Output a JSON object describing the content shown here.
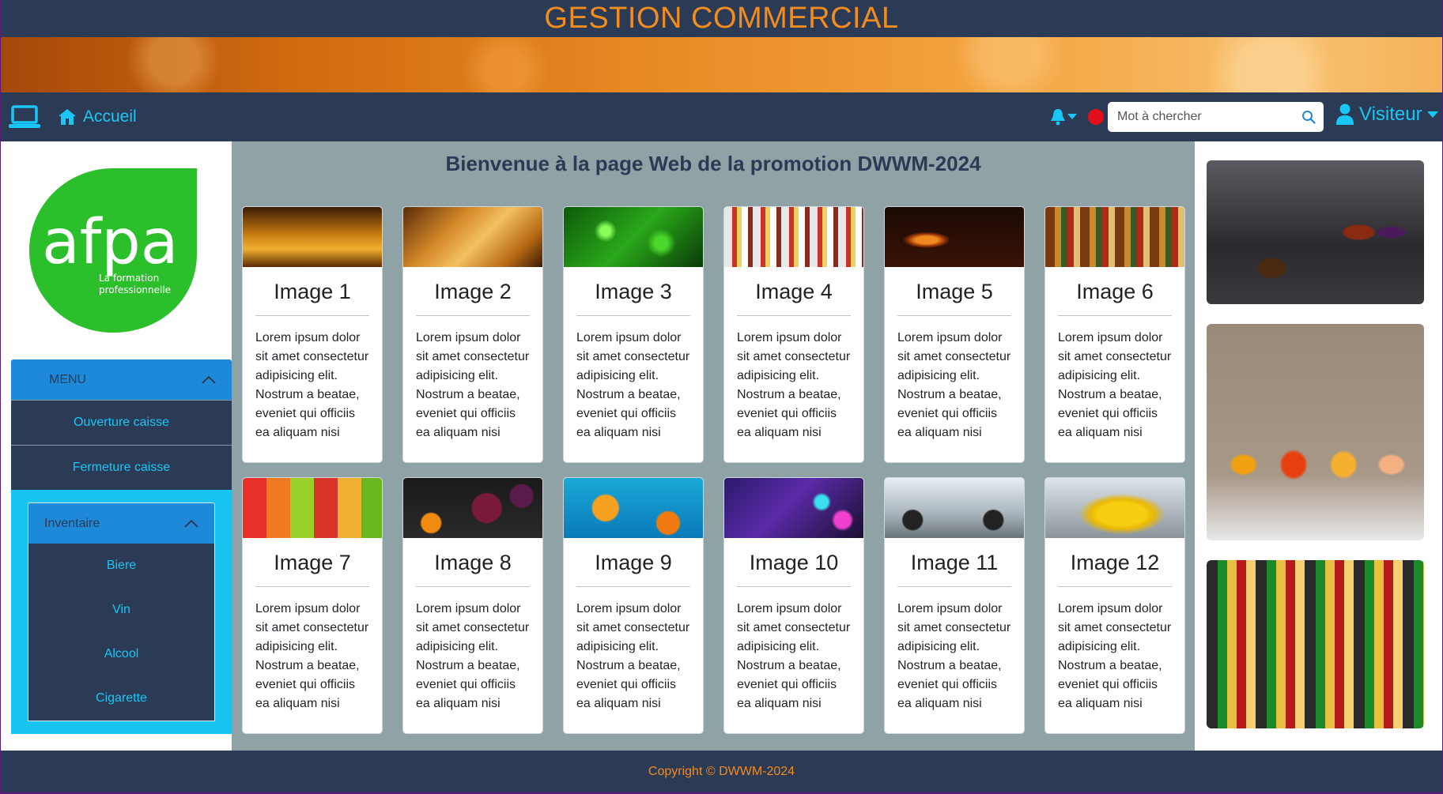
{
  "header": {
    "title": "GESTION COMMERCIAL"
  },
  "navbar": {
    "home_label": "Accueil",
    "search_placeholder": "Mot à chercher",
    "user_label": "Visiteur"
  },
  "sidebar": {
    "logo_text": "afpa",
    "logo_subtext_line1": "La formation",
    "logo_subtext_line2": "professionnelle",
    "menu_label": "MENU",
    "menu_items": [
      "Ouverture caisse",
      "Fermeture caisse"
    ],
    "inventory_label": "Inventaire",
    "inventory_items": [
      "Biere",
      "Vin",
      "Alcool",
      "Cigarette"
    ]
  },
  "main": {
    "welcome": "Bienvenue à la page Web de la promotion DWWM-2024",
    "cards": [
      {
        "title": "Image 1",
        "text": "Lorem ipsum dolor sit amet consectetur adipisicing elit. Nostrum a beatae, eveniet qui officiis ea aliquam nisi dignissimos",
        "image": "beer-barrel"
      },
      {
        "title": "Image 2",
        "text": "Lorem ipsum dolor sit amet consectetur adipisicing elit. Nostrum a beatae, eveniet qui officiis ea aliquam nisi dignissimos",
        "image": "beer-glasses"
      },
      {
        "title": "Image 3",
        "text": "Lorem ipsum dolor sit amet consectetur adipisicing elit. Nostrum a beatae, eveniet qui officiis ea aliquam nisi dignissimos",
        "image": "green-bottle"
      },
      {
        "title": "Image 4",
        "text": "Lorem ipsum dolor sit amet consectetur adipisicing elit. Nostrum a beatae, eveniet qui officiis ea aliquam nisi dignissimos",
        "image": "liquor-shelf"
      },
      {
        "title": "Image 5",
        "text": "Lorem ipsum dolor sit amet consectetur adipisicing elit. Nostrum a beatae, eveniet qui officiis ea aliquam nisi dignissimos",
        "image": "cognac-glass"
      },
      {
        "title": "Image 6",
        "text": "Lorem ipsum dolor sit amet consectetur adipisicing elit. Nostrum a beatae, eveniet qui officiis ea aliquam nisi dignissimos",
        "image": "bottles"
      },
      {
        "title": "Image 7",
        "text": "Lorem ipsum dolor sit amet consectetur adipisicing elit. Nostrum a beatae, eveniet qui officiis ea aliquam nisi dignissimos",
        "image": "smoothies"
      },
      {
        "title": "Image 8",
        "text": "Lorem ipsum dolor sit amet consectetur adipisicing elit. Nostrum a beatae, eveniet qui officiis ea aliquam nisi dignissimos",
        "image": "fruit-juices"
      },
      {
        "title": "Image 9",
        "text": "Lorem ipsum dolor sit amet consectetur adipisicing elit. Nostrum a beatae, eveniet qui officiis ea aliquam nisi dignissimos",
        "image": "orange-juice"
      },
      {
        "title": "Image 10",
        "text": "Lorem ipsum dolor sit amet consectetur adipisicing elit. Nostrum a beatae, eveniet qui officiis ea aliquam nisi dignissimos",
        "image": "gaming-pc"
      },
      {
        "title": "Image 11",
        "text": "Lorem ipsum dolor sit amet consectetur adipisicing elit. Nostrum a beatae, eveniet qui officiis ea aliquam nisi dignissimos",
        "image": "motorcycle"
      },
      {
        "title": "Image 12",
        "text": "Lorem ipsum dolor sit amet consectetur adipisicing elit. Nostrum a beatae, eveniet qui officiis ea aliquam nisi dignissimos",
        "image": "yellow-car"
      }
    ]
  },
  "right_images": [
    "whisky-bottles",
    "juice-bottles",
    "beer-bottles"
  ],
  "footer": {
    "text": "Copyright © DWWM-2024"
  },
  "colors": {
    "navy": "#2b3a55",
    "accent_orange": "#f28c1f",
    "cyan": "#19c6f5",
    "menu_blue": "#1e89d8",
    "main_bg": "#8fa2a5"
  },
  "icons": [
    "laptop-icon",
    "home-icon",
    "bell-icon",
    "notification-dot-icon",
    "search-icon",
    "user-icon",
    "chevron-up-icon"
  ]
}
